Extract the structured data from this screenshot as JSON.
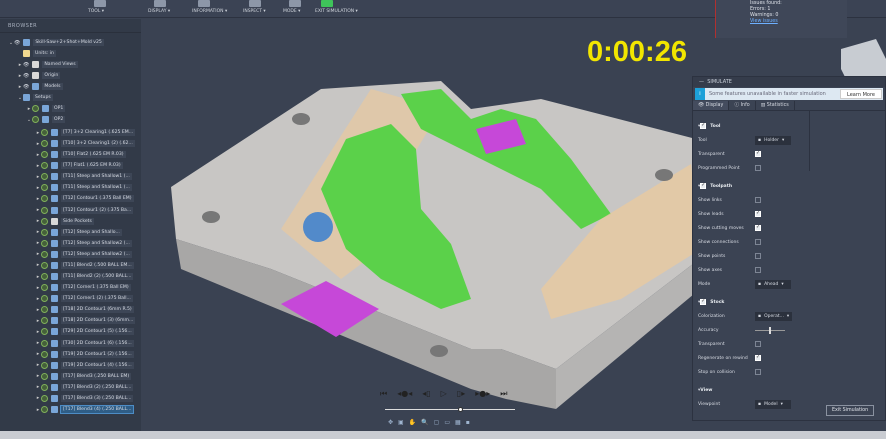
{
  "toolbar": {
    "groups": [
      "TOOL ▾",
      "DISPLAY ▾",
      "INFORMATION ▾",
      "INSPECT ▾",
      "MODE ▾",
      "EXIT SIMULATION ▾"
    ]
  },
  "browser": {
    "title": "BROWSER",
    "items": [
      {
        "label": "Skill-Saw+2+Shot+Mold v25",
        "level": 0,
        "icon": "component"
      },
      {
        "label": "Units: in",
        "level": 1,
        "icon": "document"
      },
      {
        "label": "Named Views",
        "level": 1,
        "icon": "folder"
      },
      {
        "label": "Origin",
        "level": 1,
        "icon": "folder"
      },
      {
        "label": "Models",
        "level": 1,
        "icon": "component"
      },
      {
        "label": "Setups",
        "level": 1,
        "icon": "setup"
      },
      {
        "label": "OP1",
        "level": 2,
        "icon": "setup",
        "check": true
      },
      {
        "label": "OP2",
        "level": 2,
        "icon": "setup",
        "check": true
      },
      {
        "label": "[T7] 3+2 Clearing1 (.625 EM...",
        "level": 3,
        "check": true
      },
      {
        "label": "[T10] 3+2 Clearing1 (2) (.62...",
        "level": 3,
        "check": true
      },
      {
        "label": "[T10] Flat2 (.625 EM R.03)",
        "level": 3,
        "check": true
      },
      {
        "label": "[T7] Flat1 (.625 EM R.03)",
        "level": 3,
        "check": true
      },
      {
        "label": "[T11] Steep and Shallow1 (...",
        "level": 3,
        "check": true
      },
      {
        "label": "[T11] Steep and Shallow1 (...",
        "level": 3,
        "check": true
      },
      {
        "label": "[T12] Contour1 (.375 Ball EM)",
        "level": 3,
        "check": true
      },
      {
        "label": "[T12] Contour1 (2) (.375 Ba...",
        "level": 3,
        "check": true
      },
      {
        "label": "Side Pockets",
        "level": 3,
        "check": true,
        "icon": "folder"
      },
      {
        "label": "[T12] Steep and Shallo...",
        "level": 3,
        "check": true
      },
      {
        "label": "[T12] Steep and Shallow2 (...",
        "level": 3,
        "check": true
      },
      {
        "label": "[T12] Steep and Shallow2 (...",
        "level": 3,
        "check": true
      },
      {
        "label": "[T11] Blend2 (.500 BALL EM...",
        "level": 3,
        "check": true
      },
      {
        "label": "[T11] Blend2 (2) (.500 BALL...",
        "level": 3,
        "check": true
      },
      {
        "label": "[T12] Corner1 (.375 Ball EM)",
        "level": 3,
        "check": true
      },
      {
        "label": "[T12] Corner1 (2) (.375 Ball...",
        "level": 3,
        "check": true
      },
      {
        "label": "[T18] 2D Contour1 (6mm R.5)",
        "level": 3,
        "check": true
      },
      {
        "label": "[T18] 2D Contour1 (3) (6mm...",
        "level": 3,
        "check": true
      },
      {
        "label": "[T29] 2D Contour1 (5) (.156...",
        "level": 3,
        "check": true
      },
      {
        "label": "[T30] 2D Contour1 (6) (.156...",
        "level": 3,
        "check": true
      },
      {
        "label": "[T19] 2D Contour1 (2) (.156...",
        "level": 3,
        "check": true
      },
      {
        "label": "[T19] 2D Contour1 (4) (.156...",
        "level": 3,
        "check": true
      },
      {
        "label": "[T17] Blend3 (.250 BALL EM)",
        "level": 3,
        "check": true
      },
      {
        "label": "[T17] Blend3 (2) (.250 BALL...",
        "level": 3,
        "check": true
      },
      {
        "label": "[T17] Blend3 (3) (.250 BALL...",
        "level": 3,
        "check": true
      },
      {
        "label": "[T17] Blend3 (4) (.250 BALL...",
        "level": 3,
        "check": true,
        "selected": true
      }
    ]
  },
  "timer": "0:00:26",
  "issues": {
    "line1": "Issues found:",
    "errors": "Errors: 1",
    "warnings": "Warnings: 0",
    "link": "View issues"
  },
  "simulate": {
    "title": "SIMULATE",
    "banner": "Some features unavailable in faster simulation",
    "learn_more": "Learn More",
    "tabs": [
      "Display",
      "Info",
      "Statistics"
    ],
    "rows": [
      {
        "type": "section",
        "label": "Tool",
        "checked": true
      },
      {
        "type": "dropdown",
        "label": "Tool",
        "value": "Holder"
      },
      {
        "type": "check",
        "label": "Transparent",
        "checked": true
      },
      {
        "type": "check",
        "label": "Programmed Point",
        "checked": false
      },
      {
        "type": "section",
        "label": "Toolpath",
        "checked": true
      },
      {
        "type": "check",
        "label": "Show links",
        "checked": false
      },
      {
        "type": "check",
        "label": "Show leads",
        "checked": true
      },
      {
        "type": "check",
        "label": "Show cutting moves",
        "checked": true
      },
      {
        "type": "check",
        "label": "Show connections",
        "checked": false
      },
      {
        "type": "check",
        "label": "Show points",
        "checked": false
      },
      {
        "type": "check",
        "label": "Show axes",
        "checked": false
      },
      {
        "type": "dropdown",
        "label": "Mode",
        "value": "Ahead"
      },
      {
        "type": "section",
        "label": "Stock",
        "checked": true
      },
      {
        "type": "dropdown",
        "label": "Colorization",
        "value": "Operat..."
      },
      {
        "type": "slider",
        "label": "Accuracy",
        "value": 0.5
      },
      {
        "type": "check",
        "label": "Transparent",
        "checked": false
      },
      {
        "type": "check",
        "label": "Regenerate on rewind",
        "checked": true
      },
      {
        "type": "check",
        "label": "Stop on collision",
        "checked": false
      },
      {
        "type": "section",
        "label": "View"
      },
      {
        "type": "dropdown",
        "label": "Viewpoint",
        "value": "Model"
      }
    ],
    "exit": "Exit Simulation"
  },
  "playback": {
    "buttons": [
      "⏮",
      "◂●◂",
      "◂▯",
      "▷",
      "▯▸",
      "▸●▸",
      "⏭"
    ],
    "position": 0.58
  },
  "navbar": [
    "✥",
    "▣",
    "✋",
    "🔍",
    "▢",
    "▭",
    "▦",
    "▪"
  ]
}
